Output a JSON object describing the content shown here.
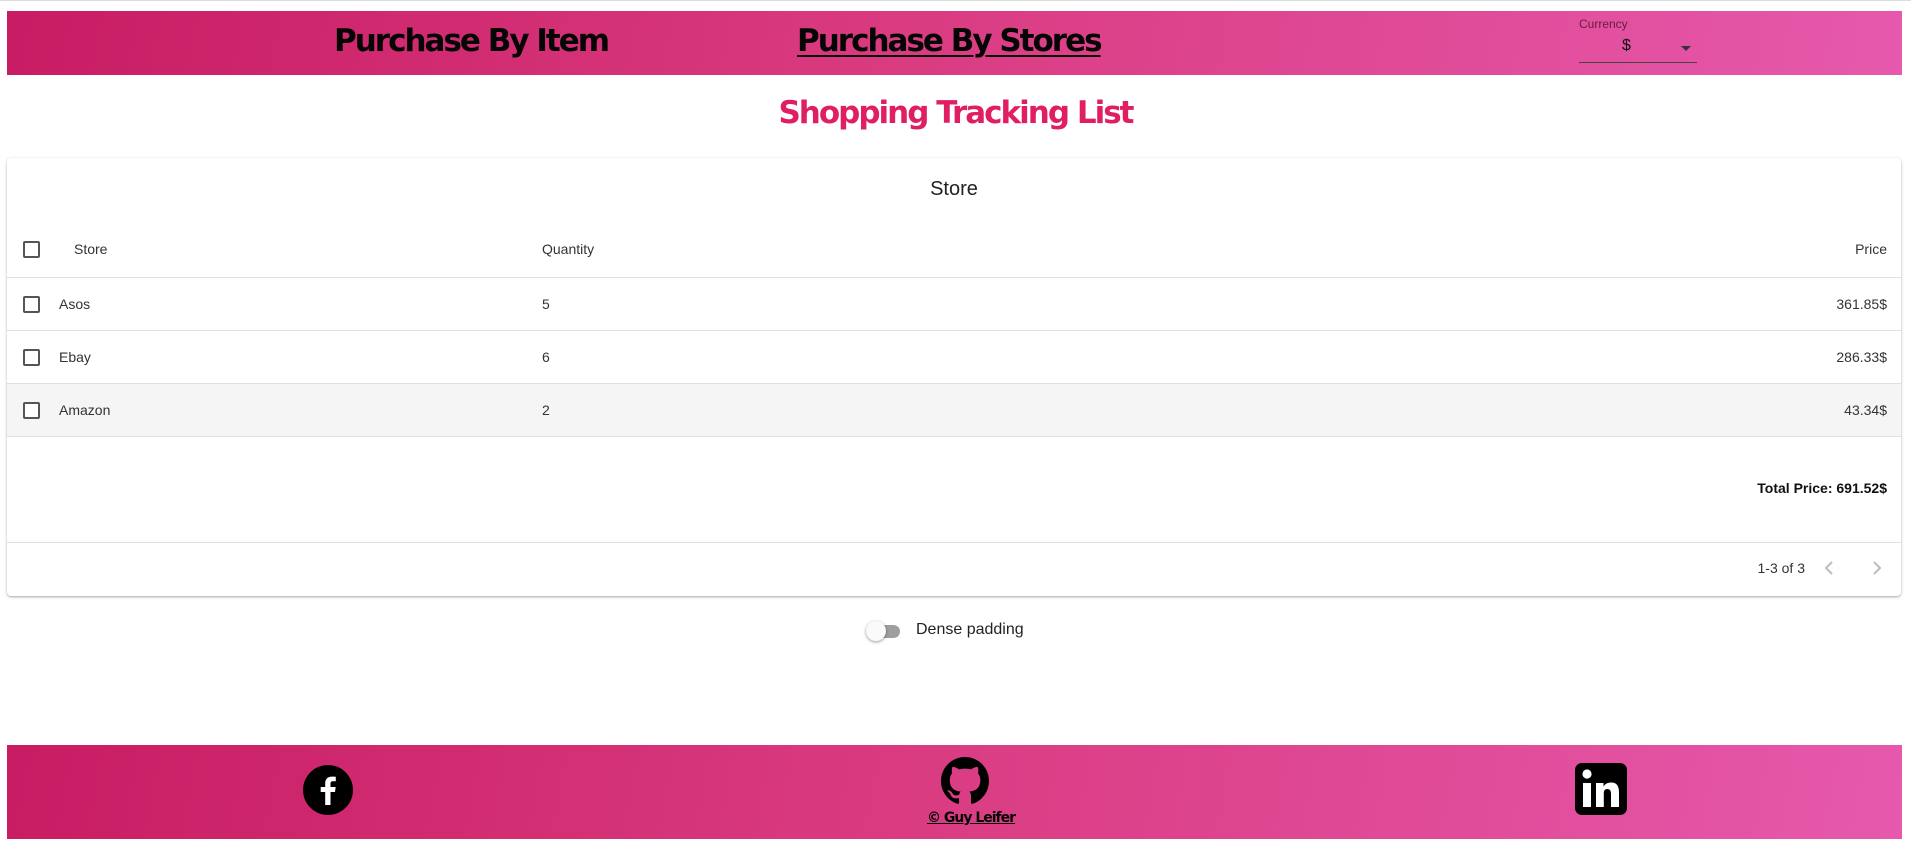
{
  "nav": {
    "purchase_by_item": "Purchase By Item",
    "purchase_by_stores": "Purchase By Stores"
  },
  "currency": {
    "label": "Currency",
    "value": "$"
  },
  "page_title": "Shopping Tracking List",
  "table": {
    "title": "Store",
    "columns": [
      "Store",
      "Quantity",
      "Price"
    ],
    "rows": [
      {
        "store": "Asos",
        "quantity": "5",
        "price": "361.85$"
      },
      {
        "store": "Ebay",
        "quantity": "6",
        "price": "286.33$"
      },
      {
        "store": "Amazon",
        "quantity": "2",
        "price": "43.34$"
      }
    ],
    "total": "Total Price: 691.52$",
    "pagination": "1-3 of 3"
  },
  "dense_padding": {
    "label": "Dense padding",
    "enabled": false
  },
  "footer": {
    "copyright": "© Guy Leifer",
    "icons": [
      "facebook-icon",
      "github-icon",
      "linkedin-icon"
    ]
  },
  "colors": {
    "accent": "#e01e63",
    "bar_gradient_start": "#c81c63",
    "bar_gradient_end": "#e659ac"
  }
}
